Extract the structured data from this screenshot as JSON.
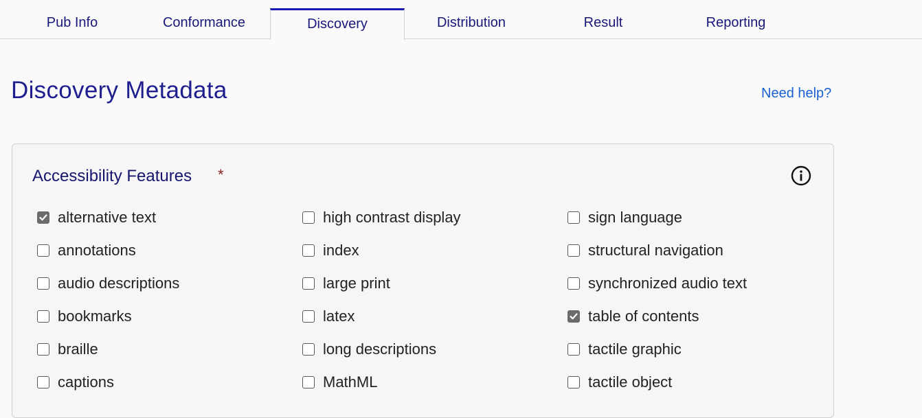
{
  "tabs": [
    {
      "label": "Pub Info",
      "active": false
    },
    {
      "label": "Conformance",
      "active": false
    },
    {
      "label": "Discovery",
      "active": true
    },
    {
      "label": "Distribution",
      "active": false
    },
    {
      "label": "Result",
      "active": false
    },
    {
      "label": "Reporting",
      "active": false
    }
  ],
  "page": {
    "title": "Discovery Metadata",
    "help_link": "Need help?"
  },
  "panel": {
    "title": "Accessibility Features",
    "required_marker": "*",
    "info_icon": "info-circle-icon",
    "options": [
      {
        "label": "alternative text",
        "checked": true
      },
      {
        "label": "annotations",
        "checked": false
      },
      {
        "label": "audio descriptions",
        "checked": false
      },
      {
        "label": "bookmarks",
        "checked": false
      },
      {
        "label": "braille",
        "checked": false
      },
      {
        "label": "captions",
        "checked": false
      },
      {
        "label": "high contrast display",
        "checked": false
      },
      {
        "label": "index",
        "checked": false
      },
      {
        "label": "large print",
        "checked": false
      },
      {
        "label": "latex",
        "checked": false
      },
      {
        "label": "long descriptions",
        "checked": false
      },
      {
        "label": "MathML",
        "checked": false
      },
      {
        "label": "sign language",
        "checked": false
      },
      {
        "label": "structural navigation",
        "checked": false
      },
      {
        "label": "synchronized audio text",
        "checked": false
      },
      {
        "label": "table of contents",
        "checked": true
      },
      {
        "label": "tactile graphic",
        "checked": false
      },
      {
        "label": "tactile object",
        "checked": false
      }
    ]
  },
  "colors": {
    "tab_text": "#18187a",
    "active_tab_border": "#1a1ab0",
    "title": "#1e1e8f",
    "link": "#1a5fd0",
    "required": "#8a2020"
  }
}
